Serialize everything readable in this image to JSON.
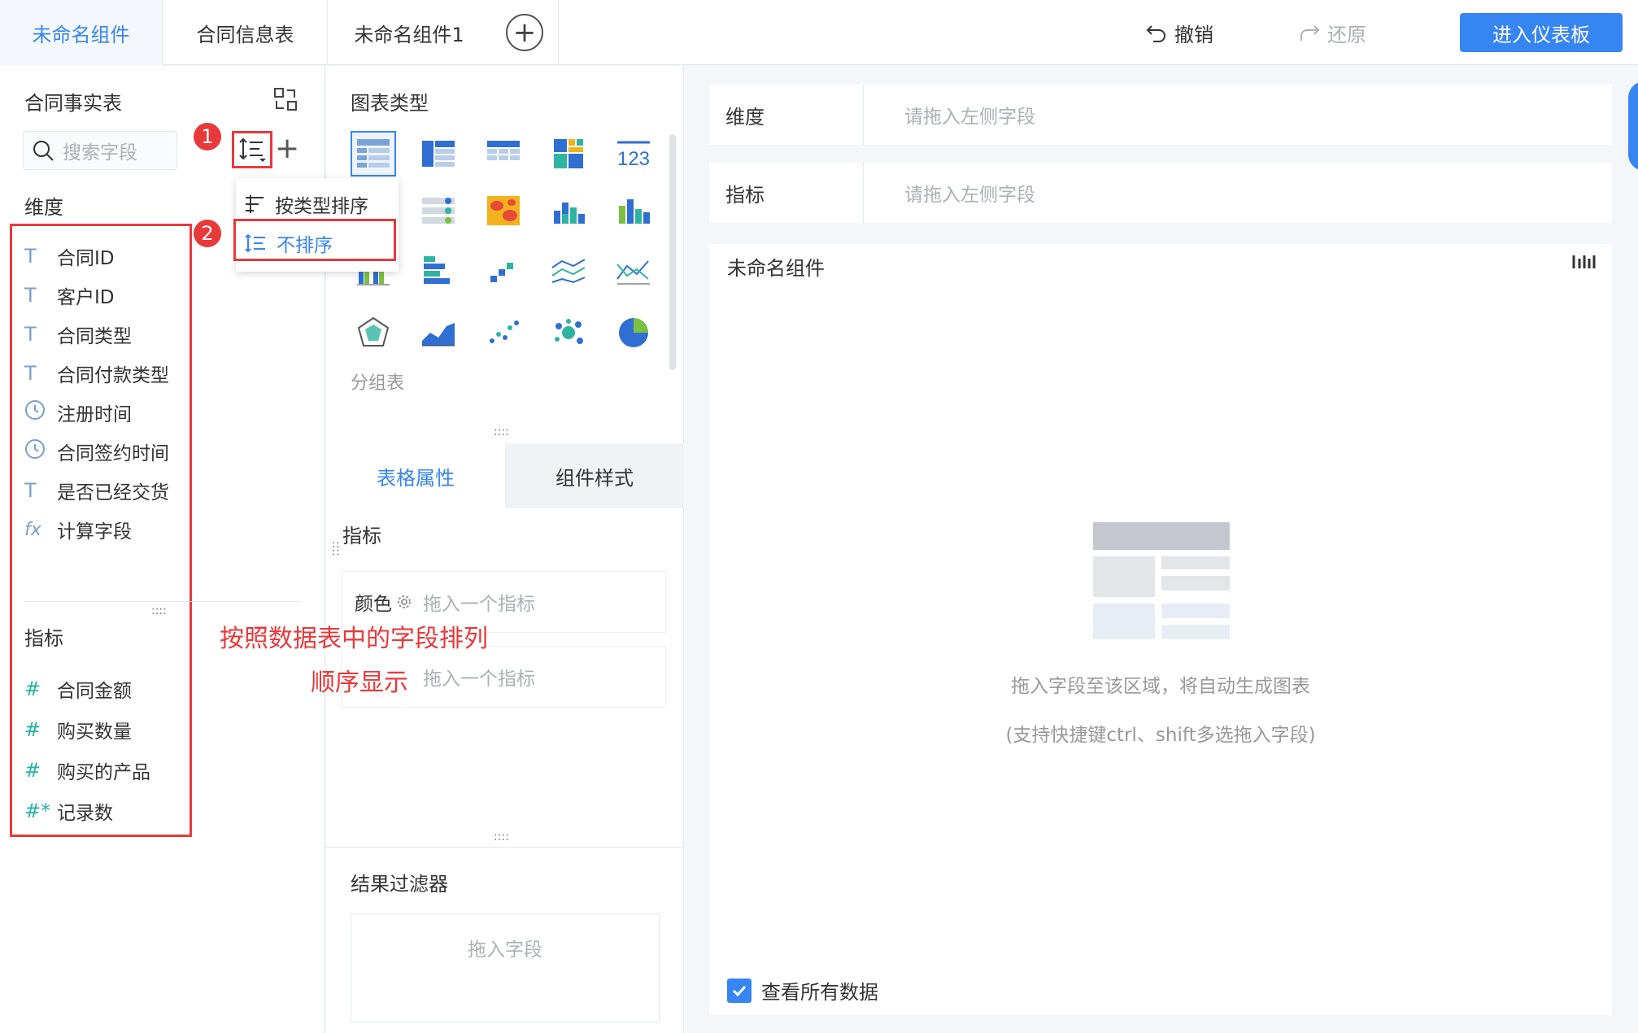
{
  "tabs": [
    "未命名组件",
    "合同信息表",
    "未命名组件1"
  ],
  "toolbar": {
    "undo": "撤销",
    "redo": "还原",
    "enter": "进入仪表板"
  },
  "left": {
    "title": "合同事实表",
    "search_placeholder": "搜索字段",
    "dim_label": "维度",
    "dims": [
      {
        "icon": "T",
        "label": "合同ID"
      },
      {
        "icon": "T",
        "label": "客户ID"
      },
      {
        "icon": "T",
        "label": "合同类型"
      },
      {
        "icon": "T",
        "label": "合同付款类型"
      },
      {
        "icon": "clock",
        "label": "注册时间"
      },
      {
        "icon": "clock",
        "label": "合同签约时间"
      },
      {
        "icon": "T",
        "label": "是否已经交货"
      },
      {
        "icon": "fx",
        "label": "计算字段"
      }
    ],
    "measure_label": "指标",
    "measures": [
      {
        "icon": "#",
        "label": "合同金额"
      },
      {
        "icon": "#",
        "label": "购买数量"
      },
      {
        "icon": "#",
        "label": "购买的产品"
      },
      {
        "icon": "#*",
        "label": "记录数"
      }
    ],
    "badges": [
      "1",
      "2"
    ]
  },
  "sort_menu": {
    "by_type": "按类型排序",
    "no_sort": "不排序"
  },
  "annotation": {
    "line1": "按照数据表中的字段排列",
    "line2": "顺序显示"
  },
  "middle": {
    "chart_type_title": "图表类型",
    "group_table_label": "分组表",
    "tab_table_attr": "表格属性",
    "tab_component_style": "组件样式",
    "measure_label": "指标",
    "color_label": "颜色",
    "drop_placeholder": "拖入一个指标",
    "result_filter": "结果过滤器",
    "drop_field": "拖入字段"
  },
  "right": {
    "dimension": "维度",
    "measure": "指标",
    "drag_hint": "请拖入左侧字段",
    "component_title": "未命名组件",
    "empty_line1": "拖入字段至该区域，将自动生成图表",
    "empty_line2": "(支持快捷键ctrl、shift多选拖入字段)",
    "view_all": "查看所有数据"
  },
  "colors": {
    "accent": "#3685f2",
    "highlight": "#e8393b"
  }
}
